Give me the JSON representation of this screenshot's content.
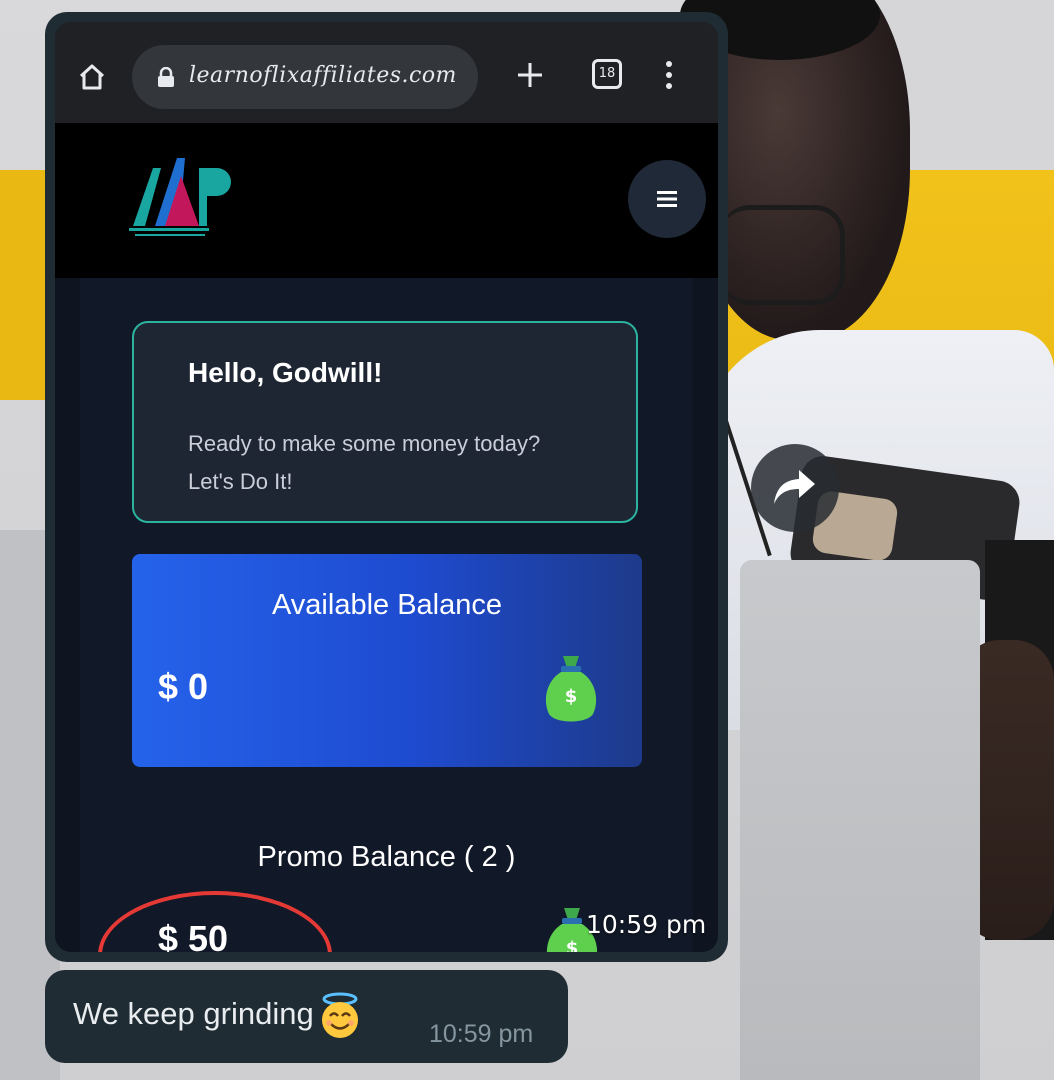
{
  "browser": {
    "url": "learnoflixaffiliates.com",
    "tab_count": "18"
  },
  "site": {
    "logo_text": "LP"
  },
  "greeting": {
    "title": "Hello, Godwill!",
    "subtitle": "Ready to make some money today? Let's Do It!"
  },
  "available_balance": {
    "label": "Available Balance",
    "amount": "$ 0"
  },
  "promo_balance": {
    "label": "Promo Balance ( 2 )",
    "amount": "$ 50"
  },
  "media_message": {
    "time": "10:59 pm"
  },
  "text_message": {
    "body": "We keep grinding",
    "time": "10:59 pm"
  },
  "colors": {
    "accent_teal": "#2bb3a0",
    "balance_blue": "#2563eb",
    "highlight_red": "#e53935",
    "bubble_bg": "#1f2c34"
  }
}
